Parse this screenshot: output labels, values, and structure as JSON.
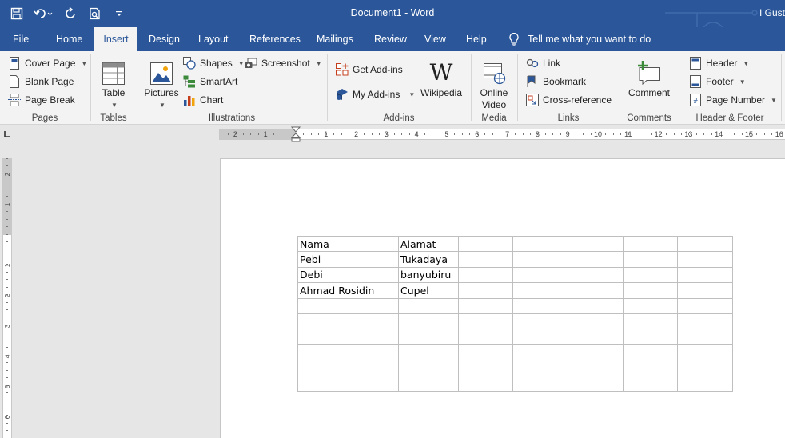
{
  "titlebar": {
    "doc_title": "Document1",
    "app_sep": " - ",
    "app_name": "Word",
    "user": "I Gust"
  },
  "tabs": [
    "File",
    "Home",
    "Insert",
    "Design",
    "Layout",
    "References",
    "Mailings",
    "Review",
    "View",
    "Help"
  ],
  "tell_me": "Tell me what you want to do",
  "ribbon": {
    "pages": {
      "label": "Pages",
      "cover_page": "Cover Page",
      "blank_page": "Blank Page",
      "page_break": "Page Break"
    },
    "tables": {
      "label": "Tables",
      "table": "Table"
    },
    "illustrations": {
      "label": "Illustrations",
      "pictures": "Pictures",
      "shapes": "Shapes",
      "smartart": "SmartArt",
      "chart": "Chart",
      "screenshot": "Screenshot"
    },
    "addins": {
      "label": "Add-ins",
      "get_addins": "Get Add-ins",
      "my_addins": "My Add-ins",
      "wikipedia": "Wikipedia"
    },
    "media": {
      "label": "Media",
      "online_video_1": "Online",
      "online_video_2": "Video"
    },
    "links": {
      "label": "Links",
      "link": "Link",
      "bookmark": "Bookmark",
      "cross_reference": "Cross-reference"
    },
    "comments": {
      "label": "Comments",
      "comment": "Comment"
    },
    "header_footer": {
      "label": "Header & Footer",
      "header": "Header",
      "footer": "Footer",
      "page_number": "Page Number"
    }
  },
  "ruler": {
    "h_left": [
      "2",
      "1"
    ],
    "h_right": [
      "1",
      "2",
      "3",
      "4",
      "5",
      "6",
      "7",
      "8",
      "9",
      "10",
      "11",
      "12",
      "13",
      "14",
      "15",
      "16"
    ],
    "v": [
      "2",
      "1",
      "1",
      "2",
      "3",
      "4",
      "5",
      "6"
    ]
  },
  "document": {
    "table": [
      [
        "Nama",
        "Alamat",
        "",
        "",
        "",
        "",
        ""
      ],
      [
        "Pebi",
        "Tukadaya",
        "",
        "",
        "",
        "",
        ""
      ],
      [
        "Debi",
        "banyubiru",
        "",
        "",
        "",
        "",
        ""
      ],
      [
        "Ahmad Rosidin",
        "Cupel",
        "",
        "",
        "",
        "",
        ""
      ],
      [
        "",
        "",
        "",
        "",
        "",
        "",
        ""
      ],
      [
        "",
        "",
        "",
        "",
        "",
        "",
        ""
      ],
      [
        "",
        "",
        "",
        "",
        "",
        "",
        ""
      ],
      [
        "",
        "",
        "",
        "",
        "",
        "",
        ""
      ],
      [
        "",
        "",
        "",
        "",
        "",
        "",
        ""
      ],
      [
        "",
        "",
        "",
        "",
        "",
        "",
        ""
      ]
    ]
  },
  "colors": {
    "accent": "#2b579a",
    "ribbon_bg": "#f3f3f3",
    "canvas_bg": "#e6e6e6"
  }
}
